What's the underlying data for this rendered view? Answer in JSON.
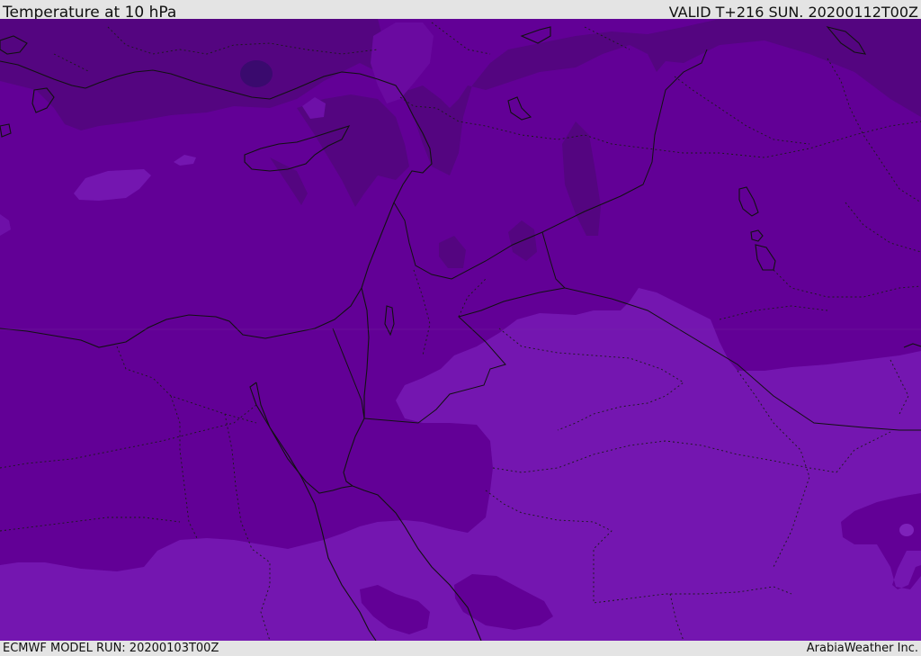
{
  "header": {
    "title": "Temperature at 10 hPa",
    "valid": "VALID T+216 SUN. 20200112T00Z"
  },
  "footer": {
    "model_run": "ECMWF MODEL RUN: 20200103T00Z",
    "credit": "ArabiaWeather Inc."
  },
  "colors": {
    "darkest": "#3a0a6e",
    "dark": "#540580",
    "medium": "#620096",
    "light": "#7416b0",
    "lighter": "#7e22ba",
    "coast": "#111111"
  }
}
